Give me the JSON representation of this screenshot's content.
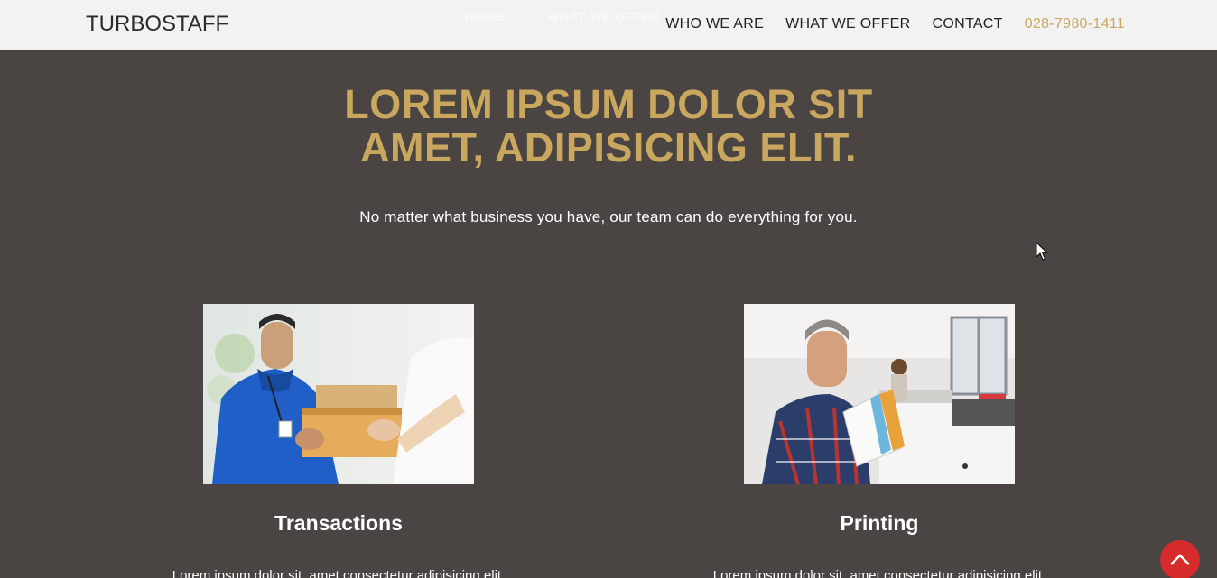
{
  "header": {
    "logo": "TURBOSTAFF",
    "ghost_links": [
      "HOME",
      "WHAT WE OFFER"
    ],
    "nav": [
      {
        "label": "WHO WE ARE"
      },
      {
        "label": "WHAT WE OFFER"
      },
      {
        "label": "CONTACT"
      }
    ],
    "phone": "028-7980-1411"
  },
  "hero": {
    "title_line1": "LOREM IPSUM DOLOR SIT",
    "title_line2": "AMET, ADIPISICING ELIT.",
    "subtitle": "No matter what business you have, our team can do everything for you."
  },
  "cards": [
    {
      "title": "Transactions",
      "description": "Lorem ipsum dolor sit, amet consectetur adipisicing elit.",
      "image": "delivery-handoff-photo"
    },
    {
      "title": "Printing",
      "description": "Lorem ipsum dolor sit, amet consectetur adipisicing elit.",
      "image": "man-reading-print-photo"
    }
  ],
  "icons": {
    "scroll_top": "chevron-up-icon",
    "cursor": "mouse-pointer-icon"
  },
  "colors": {
    "accent_gold": "#c9a75e",
    "background": "#4a4543",
    "navbar": "#f2f2f2",
    "scroll_button": "#d62b2b"
  }
}
